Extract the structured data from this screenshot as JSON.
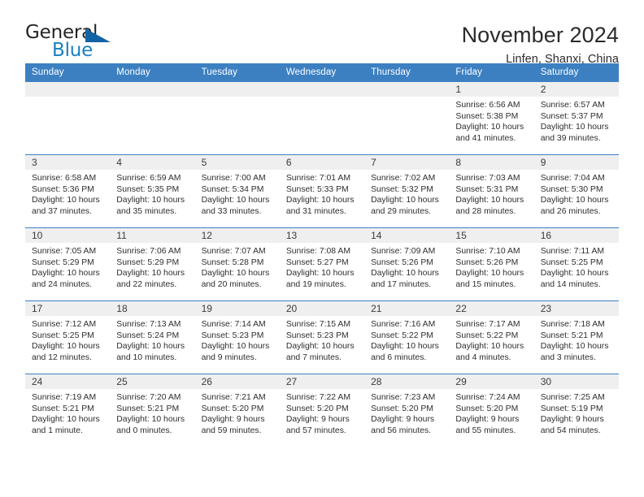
{
  "brand": {
    "name_part1": "General",
    "name_part2": "Blue",
    "accent_color": "#1a7fc1",
    "triangle_color": "#1263a6"
  },
  "header": {
    "title": "November 2024",
    "subtitle": "Linfen, Shanxi, China"
  },
  "calendar": {
    "header_bg": "#3c80c2",
    "daynum_bg": "#efefef",
    "weekday_headers": [
      "Sunday",
      "Monday",
      "Tuesday",
      "Wednesday",
      "Thursday",
      "Friday",
      "Saturday"
    ],
    "weeks": [
      [
        {
          "day": "",
          "empty": true
        },
        {
          "day": "",
          "empty": true
        },
        {
          "day": "",
          "empty": true
        },
        {
          "day": "",
          "empty": true
        },
        {
          "day": "",
          "empty": true
        },
        {
          "day": "1",
          "sunrise": "Sunrise: 6:56 AM",
          "sunset": "Sunset: 5:38 PM",
          "daylight_line1": "Daylight: 10 hours",
          "daylight_line2": "and 41 minutes."
        },
        {
          "day": "2",
          "sunrise": "Sunrise: 6:57 AM",
          "sunset": "Sunset: 5:37 PM",
          "daylight_line1": "Daylight: 10 hours",
          "daylight_line2": "and 39 minutes."
        }
      ],
      [
        {
          "day": "3",
          "sunrise": "Sunrise: 6:58 AM",
          "sunset": "Sunset: 5:36 PM",
          "daylight_line1": "Daylight: 10 hours",
          "daylight_line2": "and 37 minutes."
        },
        {
          "day": "4",
          "sunrise": "Sunrise: 6:59 AM",
          "sunset": "Sunset: 5:35 PM",
          "daylight_line1": "Daylight: 10 hours",
          "daylight_line2": "and 35 minutes."
        },
        {
          "day": "5",
          "sunrise": "Sunrise: 7:00 AM",
          "sunset": "Sunset: 5:34 PM",
          "daylight_line1": "Daylight: 10 hours",
          "daylight_line2": "and 33 minutes."
        },
        {
          "day": "6",
          "sunrise": "Sunrise: 7:01 AM",
          "sunset": "Sunset: 5:33 PM",
          "daylight_line1": "Daylight: 10 hours",
          "daylight_line2": "and 31 minutes."
        },
        {
          "day": "7",
          "sunrise": "Sunrise: 7:02 AM",
          "sunset": "Sunset: 5:32 PM",
          "daylight_line1": "Daylight: 10 hours",
          "daylight_line2": "and 29 minutes."
        },
        {
          "day": "8",
          "sunrise": "Sunrise: 7:03 AM",
          "sunset": "Sunset: 5:31 PM",
          "daylight_line1": "Daylight: 10 hours",
          "daylight_line2": "and 28 minutes."
        },
        {
          "day": "9",
          "sunrise": "Sunrise: 7:04 AM",
          "sunset": "Sunset: 5:30 PM",
          "daylight_line1": "Daylight: 10 hours",
          "daylight_line2": "and 26 minutes."
        }
      ],
      [
        {
          "day": "10",
          "sunrise": "Sunrise: 7:05 AM",
          "sunset": "Sunset: 5:29 PM",
          "daylight_line1": "Daylight: 10 hours",
          "daylight_line2": "and 24 minutes."
        },
        {
          "day": "11",
          "sunrise": "Sunrise: 7:06 AM",
          "sunset": "Sunset: 5:29 PM",
          "daylight_line1": "Daylight: 10 hours",
          "daylight_line2": "and 22 minutes."
        },
        {
          "day": "12",
          "sunrise": "Sunrise: 7:07 AM",
          "sunset": "Sunset: 5:28 PM",
          "daylight_line1": "Daylight: 10 hours",
          "daylight_line2": "and 20 minutes."
        },
        {
          "day": "13",
          "sunrise": "Sunrise: 7:08 AM",
          "sunset": "Sunset: 5:27 PM",
          "daylight_line1": "Daylight: 10 hours",
          "daylight_line2": "and 19 minutes."
        },
        {
          "day": "14",
          "sunrise": "Sunrise: 7:09 AM",
          "sunset": "Sunset: 5:26 PM",
          "daylight_line1": "Daylight: 10 hours",
          "daylight_line2": "and 17 minutes."
        },
        {
          "day": "15",
          "sunrise": "Sunrise: 7:10 AM",
          "sunset": "Sunset: 5:26 PM",
          "daylight_line1": "Daylight: 10 hours",
          "daylight_line2": "and 15 minutes."
        },
        {
          "day": "16",
          "sunrise": "Sunrise: 7:11 AM",
          "sunset": "Sunset: 5:25 PM",
          "daylight_line1": "Daylight: 10 hours",
          "daylight_line2": "and 14 minutes."
        }
      ],
      [
        {
          "day": "17",
          "sunrise": "Sunrise: 7:12 AM",
          "sunset": "Sunset: 5:25 PM",
          "daylight_line1": "Daylight: 10 hours",
          "daylight_line2": "and 12 minutes."
        },
        {
          "day": "18",
          "sunrise": "Sunrise: 7:13 AM",
          "sunset": "Sunset: 5:24 PM",
          "daylight_line1": "Daylight: 10 hours",
          "daylight_line2": "and 10 minutes."
        },
        {
          "day": "19",
          "sunrise": "Sunrise: 7:14 AM",
          "sunset": "Sunset: 5:23 PM",
          "daylight_line1": "Daylight: 10 hours",
          "daylight_line2": "and 9 minutes."
        },
        {
          "day": "20",
          "sunrise": "Sunrise: 7:15 AM",
          "sunset": "Sunset: 5:23 PM",
          "daylight_line1": "Daylight: 10 hours",
          "daylight_line2": "and 7 minutes."
        },
        {
          "day": "21",
          "sunrise": "Sunrise: 7:16 AM",
          "sunset": "Sunset: 5:22 PM",
          "daylight_line1": "Daylight: 10 hours",
          "daylight_line2": "and 6 minutes."
        },
        {
          "day": "22",
          "sunrise": "Sunrise: 7:17 AM",
          "sunset": "Sunset: 5:22 PM",
          "daylight_line1": "Daylight: 10 hours",
          "daylight_line2": "and 4 minutes."
        },
        {
          "day": "23",
          "sunrise": "Sunrise: 7:18 AM",
          "sunset": "Sunset: 5:21 PM",
          "daylight_line1": "Daylight: 10 hours",
          "daylight_line2": "and 3 minutes."
        }
      ],
      [
        {
          "day": "24",
          "sunrise": "Sunrise: 7:19 AM",
          "sunset": "Sunset: 5:21 PM",
          "daylight_line1": "Daylight: 10 hours",
          "daylight_line2": "and 1 minute."
        },
        {
          "day": "25",
          "sunrise": "Sunrise: 7:20 AM",
          "sunset": "Sunset: 5:21 PM",
          "daylight_line1": "Daylight: 10 hours",
          "daylight_line2": "and 0 minutes."
        },
        {
          "day": "26",
          "sunrise": "Sunrise: 7:21 AM",
          "sunset": "Sunset: 5:20 PM",
          "daylight_line1": "Daylight: 9 hours",
          "daylight_line2": "and 59 minutes."
        },
        {
          "day": "27",
          "sunrise": "Sunrise: 7:22 AM",
          "sunset": "Sunset: 5:20 PM",
          "daylight_line1": "Daylight: 9 hours",
          "daylight_line2": "and 57 minutes."
        },
        {
          "day": "28",
          "sunrise": "Sunrise: 7:23 AM",
          "sunset": "Sunset: 5:20 PM",
          "daylight_line1": "Daylight: 9 hours",
          "daylight_line2": "and 56 minutes."
        },
        {
          "day": "29",
          "sunrise": "Sunrise: 7:24 AM",
          "sunset": "Sunset: 5:20 PM",
          "daylight_line1": "Daylight: 9 hours",
          "daylight_line2": "and 55 minutes."
        },
        {
          "day": "30",
          "sunrise": "Sunrise: 7:25 AM",
          "sunset": "Sunset: 5:19 PM",
          "daylight_line1": "Daylight: 9 hours",
          "daylight_line2": "and 54 minutes."
        }
      ]
    ]
  }
}
